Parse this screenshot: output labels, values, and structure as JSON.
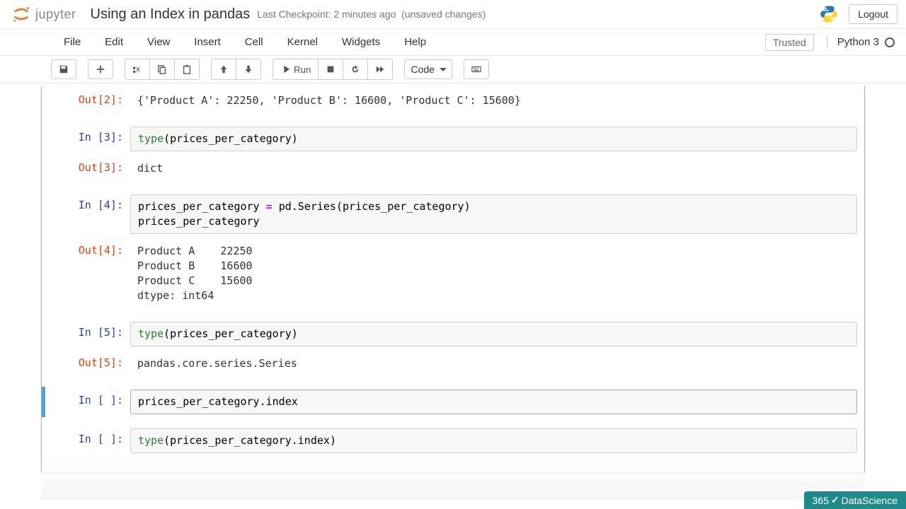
{
  "header": {
    "logo_text": "jupyter",
    "title": "Using an Index in pandas",
    "checkpoint": "Last Checkpoint: 2 minutes ago",
    "unsaved": "(unsaved changes)",
    "logout": "Logout"
  },
  "menu": {
    "items": [
      "File",
      "Edit",
      "View",
      "Insert",
      "Cell",
      "Kernel",
      "Widgets",
      "Help"
    ],
    "trusted": "Trusted",
    "kernel": "Python 3"
  },
  "toolbar": {
    "run_label": "Run",
    "celltype": "Code"
  },
  "cells": [
    {
      "out_prompt": "Out[2]:",
      "output": "{'Product A': 22250, 'Product B': 16600, 'Product C': 15600}"
    },
    {
      "in_prompt": "In [3]:",
      "code_plain": "type(prices_per_category)",
      "out_prompt": "Out[3]:",
      "output": "dict"
    },
    {
      "in_prompt": "In [4]:",
      "code_plain": "prices_per_category = pd.Series(prices_per_category)\nprices_per_category",
      "out_prompt": "Out[4]:",
      "output": "Product A    22250\nProduct B    16600\nProduct C    15600\ndtype: int64"
    },
    {
      "in_prompt": "In [5]:",
      "code_plain": "type(prices_per_category)",
      "out_prompt": "Out[5]:",
      "output": "pandas.core.series.Series"
    },
    {
      "in_prompt": "In [ ]:",
      "code_plain": "prices_per_category.index",
      "selected": true
    },
    {
      "in_prompt": "In [ ]:",
      "code_plain": "type(prices_per_category.index)"
    }
  ],
  "watermark": {
    "brand_a": "365",
    "brand_b": "DataScience"
  }
}
